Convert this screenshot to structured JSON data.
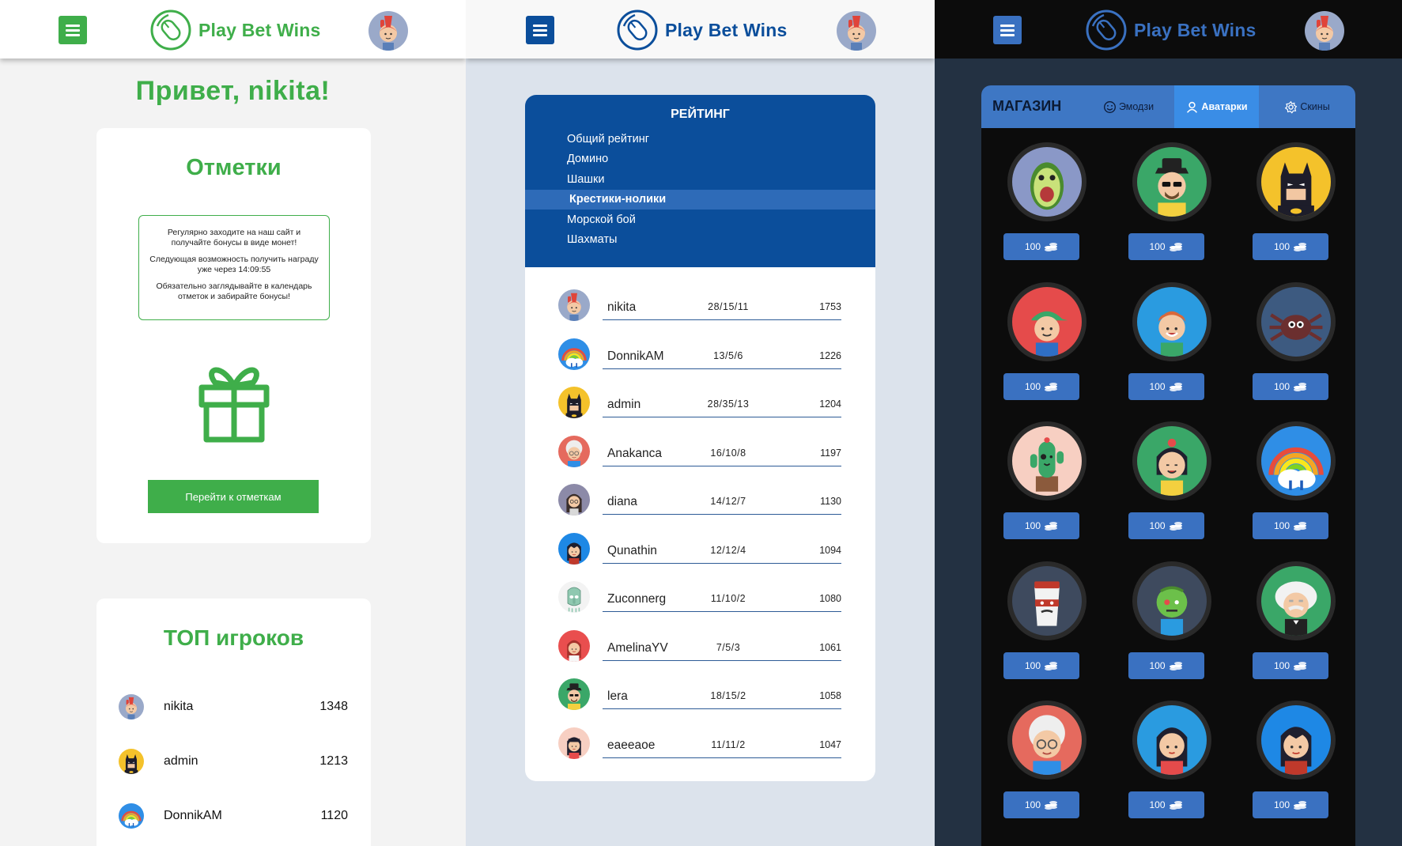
{
  "brand": "Play Bet Wins",
  "colors": {
    "green": "#3fae4a",
    "blue": "#0b4e9b",
    "dark": "#0c0c0c"
  },
  "left": {
    "greeting": "Привет, nikita!",
    "marks": {
      "title": "Отметки",
      "notice": [
        "Регулярно заходите на наш сайт и получайте бонусы в виде монет!",
        "Следующая возможность получить награду уже через 14:09:55",
        "Обязательно заглядывайте в календарь отметок и забирайте бонусы!"
      ],
      "button": "Перейти к отметкам"
    },
    "top": {
      "title": "ТОП игроков",
      "rows": [
        {
          "name": "nikita",
          "score": "1348",
          "avatar": "boy-mohawk"
        },
        {
          "name": "admin",
          "score": "1213",
          "avatar": "batman"
        },
        {
          "name": "DonnikAM",
          "score": "1120",
          "avatar": "rainbow-cloud"
        }
      ]
    }
  },
  "middle": {
    "title": "РЕЙТИНГ",
    "menu": [
      "Общий рейтинг",
      "Домино",
      "Шашки",
      "Крестики-нолики",
      "Морской бой",
      "Шахматы"
    ],
    "active_menu": 3,
    "rows": [
      {
        "name": "nikita",
        "stats": "28/15/11",
        "score": "1753",
        "avatar": "boy-mohawk"
      },
      {
        "name": "DonnikAM",
        "stats": "13/5/6",
        "score": "1226",
        "avatar": "rainbow-cloud"
      },
      {
        "name": "admin",
        "stats": "28/35/13",
        "score": "1204",
        "avatar": "batman"
      },
      {
        "name": "Anakanca",
        "stats": "16/10/8",
        "score": "1197",
        "avatar": "grandma"
      },
      {
        "name": "diana",
        "stats": "14/12/7",
        "score": "1130",
        "avatar": "girl-glasses"
      },
      {
        "name": "Qunathin",
        "stats": "12/12/4",
        "score": "1094",
        "avatar": "girl-dark"
      },
      {
        "name": "Zuconnerg",
        "stats": "11/10/2",
        "score": "1080",
        "avatar": "squid"
      },
      {
        "name": "AmelinaYV",
        "stats": "7/5/3",
        "score": "1061",
        "avatar": "girl-red"
      },
      {
        "name": "lera",
        "stats": "18/15/2",
        "score": "1058",
        "avatar": "heisenberg"
      },
      {
        "name": "eaeeaoe",
        "stats": "11/11/2",
        "score": "1047",
        "avatar": "girl-black"
      }
    ]
  },
  "right": {
    "shop_title": "МАГАЗИН",
    "tabs": [
      {
        "label": "Эмодзи",
        "icon": "smile-icon"
      },
      {
        "label": "Аватарки",
        "icon": "user-icon"
      },
      {
        "label": "Скины",
        "icon": "gear-icon"
      }
    ],
    "active_tab": 1,
    "price": "100",
    "items": [
      "avocado",
      "heisenberg",
      "batman",
      "cap-boy",
      "boy-ginger",
      "spider",
      "cactus",
      "girl-green",
      "rainbow-cloud",
      "coffee-bandit",
      "zombie",
      "einstein",
      "grandma",
      "girl-blue",
      "girl-dark"
    ]
  }
}
